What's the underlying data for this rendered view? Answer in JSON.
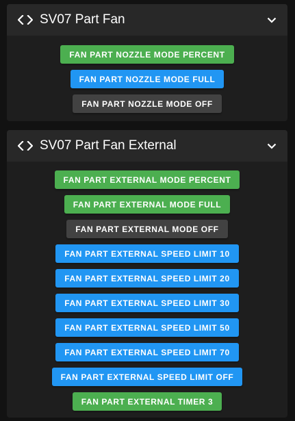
{
  "colors": {
    "green": "#4caf50",
    "blue": "#2196f3",
    "grey": "#424242"
  },
  "panels": [
    {
      "title": "SV07 Part Fan",
      "icon": "code-icon",
      "toggle_icon": "chevron-down-icon",
      "buttons": [
        {
          "label": "FAN PART NOZZLE MODE PERCENT",
          "color": "green"
        },
        {
          "label": "FAN PART NOZZLE MODE FULL",
          "color": "blue"
        },
        {
          "label": "FAN PART NOZZLE MODE OFF",
          "color": "grey"
        }
      ]
    },
    {
      "title": "SV07 Part Fan External",
      "icon": "code-icon",
      "toggle_icon": "chevron-down-icon",
      "buttons": [
        {
          "label": "FAN PART EXTERNAL MODE PERCENT",
          "color": "green"
        },
        {
          "label": "FAN PART EXTERNAL MODE FULL",
          "color": "green"
        },
        {
          "label": "FAN PART EXTERNAL MODE OFF",
          "color": "grey"
        },
        {
          "label": "FAN PART EXTERNAL SPEED LIMIT 10",
          "color": "blue"
        },
        {
          "label": "FAN PART EXTERNAL SPEED LIMIT 20",
          "color": "blue"
        },
        {
          "label": "FAN PART EXTERNAL SPEED LIMIT 30",
          "color": "blue"
        },
        {
          "label": "FAN PART EXTERNAL SPEED LIMIT 50",
          "color": "blue"
        },
        {
          "label": "FAN PART EXTERNAL SPEED LIMIT 70",
          "color": "blue"
        },
        {
          "label": "FAN PART EXTERNAL SPEED LIMIT OFF",
          "color": "blue"
        },
        {
          "label": "FAN PART EXTERNAL TIMER 3",
          "color": "green"
        }
      ]
    }
  ]
}
